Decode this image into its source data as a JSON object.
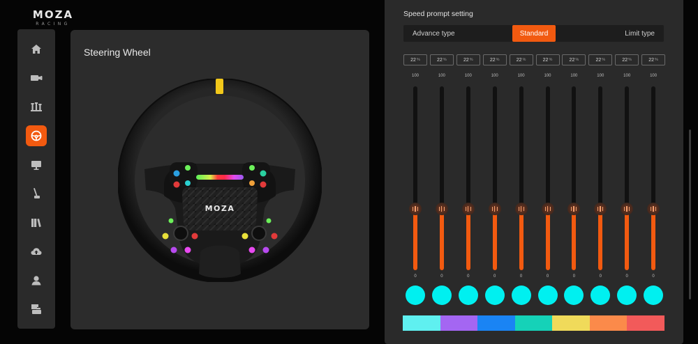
{
  "logo": {
    "main": "MOZA",
    "sub": "RACING"
  },
  "sidebar": {
    "items": [
      {
        "name": "home",
        "icon": "home-icon",
        "active": false
      },
      {
        "name": "wheelbase",
        "icon": "wheelbase-icon",
        "active": false
      },
      {
        "name": "pedals",
        "icon": "pedals-icon",
        "active": false
      },
      {
        "name": "steering-wheel",
        "icon": "steering-wheel-icon",
        "active": true
      },
      {
        "name": "display",
        "icon": "monitor-icon",
        "active": false
      },
      {
        "name": "handbrake",
        "icon": "handbrake-icon",
        "active": false
      },
      {
        "name": "library",
        "icon": "library-icon",
        "active": false
      },
      {
        "name": "cloud",
        "icon": "cloud-upload-icon",
        "active": false
      },
      {
        "name": "profile",
        "icon": "user-icon",
        "active": false
      },
      {
        "name": "about",
        "icon": "info-card-icon",
        "active": false
      }
    ]
  },
  "wheel_panel": {
    "title": "Steering Wheel",
    "hub_logo": "MOZA"
  },
  "speed_prompt": {
    "title": "Speed prompt setting",
    "modes": {
      "left": "Advance type",
      "selected": "Standard",
      "right": "Limit type"
    }
  },
  "channels": [
    {
      "value": "22",
      "unit": "%",
      "max": "100",
      "min": "0",
      "level": 0.31,
      "color": "#00f0f0"
    },
    {
      "value": "22",
      "unit": "%",
      "max": "100",
      "min": "0",
      "level": 0.31,
      "color": "#00f0f0"
    },
    {
      "value": "22",
      "unit": "%",
      "max": "100",
      "min": "0",
      "level": 0.31,
      "color": "#00f0f0"
    },
    {
      "value": "22",
      "unit": "%",
      "max": "100",
      "min": "0",
      "level": 0.31,
      "color": "#00f0f0"
    },
    {
      "value": "22",
      "unit": "%",
      "max": "100",
      "min": "0",
      "level": 0.31,
      "color": "#00f0f0"
    },
    {
      "value": "22",
      "unit": "%",
      "max": "100",
      "min": "0",
      "level": 0.31,
      "color": "#00f0f0"
    },
    {
      "value": "22",
      "unit": "%",
      "max": "100",
      "min": "0",
      "level": 0.31,
      "color": "#00f0f0"
    },
    {
      "value": "22",
      "unit": "%",
      "max": "100",
      "min": "0",
      "level": 0.31,
      "color": "#00f0f0"
    },
    {
      "value": "22",
      "unit": "%",
      "max": "100",
      "min": "0",
      "level": 0.31,
      "color": "#00f0f0"
    },
    {
      "value": "22",
      "unit": "%",
      "max": "100",
      "min": "0",
      "level": 0.31,
      "color": "#00f0f0"
    }
  ],
  "palette": [
    "#5ff0f0",
    "#a466f2",
    "#1a84f4",
    "#15d2b8",
    "#f0da5a",
    "#fb8a4a",
    "#f25a5a"
  ],
  "colors": {
    "accent": "#f25a10",
    "panel": "#2c2c2c",
    "background": "#050505"
  }
}
